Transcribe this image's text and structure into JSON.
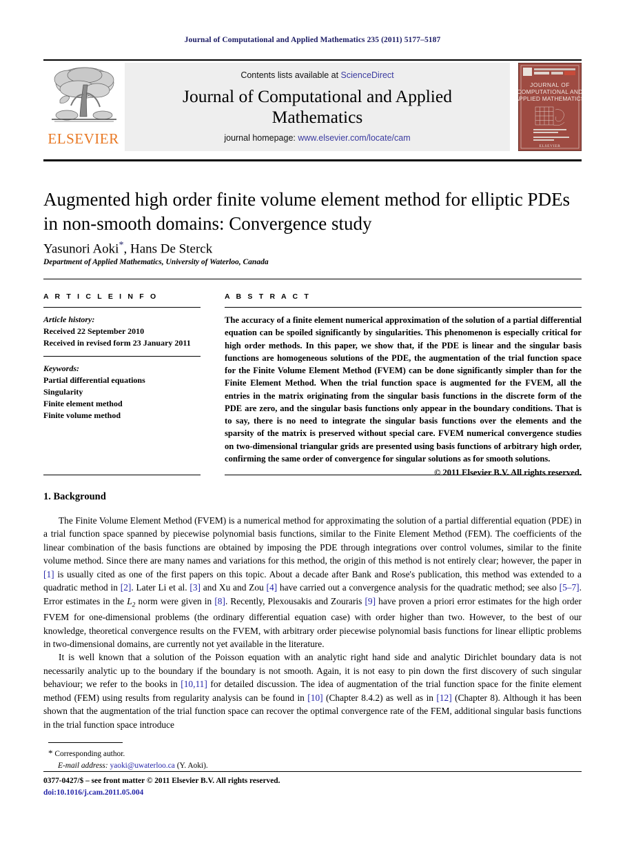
{
  "running_head": "Journal of Computational and Applied Mathematics 235 (2011) 5177–5187",
  "masthead": {
    "publisher_name": "ELSEVIER",
    "contents_prefix": "Contents lists available at ",
    "contents_link": "ScienceDirect",
    "journal_title": "Journal of Computational and Applied Mathematics",
    "homepage_prefix": "journal homepage: ",
    "homepage_url": "www.elsevier.com/locate/cam",
    "cover": {
      "line1": "JOURNAL OF",
      "line2": "COMPUTATIONAL AND",
      "line3": "APPLIED MATHEMATICS",
      "footer": "ELSEVIER"
    }
  },
  "article": {
    "title": "Augmented high order finite volume element method for elliptic PDEs in non-smooth domains: Convergence study",
    "authors": "Yasunori Aoki",
    "authors_rest": ", Hans De Sterck",
    "corresponding_marker": "*",
    "affiliation": "Department of Applied Mathematics, University of Waterloo, Canada"
  },
  "info": {
    "heading": "A R T I C L E    I N F O",
    "history_label": "Article history:",
    "history": [
      "Received 22 September 2010",
      "Received in revised form 23 January 2011"
    ],
    "keywords_label": "Keywords:",
    "keywords": [
      "Partial differential equations",
      "Singularity",
      "Finite element method",
      "Finite volume method"
    ]
  },
  "abstract": {
    "heading": "A B S T R A C T",
    "text": "The accuracy of a finite element numerical approximation of the solution of a partial differential equation can be spoiled significantly by singularities. This phenomenon is especially critical for high order methods. In this paper, we show that, if the PDE is linear and the singular basis functions are homogeneous solutions of the PDE, the augmentation of the trial function space for the Finite Volume Element Method (FVEM) can be done significantly simpler than for the Finite Element Method. When the trial function space is augmented for the FVEM, all the entries in the matrix originating from the singular basis functions in the discrete form of the PDE are zero, and the singular basis functions only appear in the boundary conditions. That is to say, there is no need to integrate the singular basis functions over the elements and the sparsity of the matrix is preserved without special care. FVEM numerical convergence studies on two-dimensional triangular grids are presented using basis functions of arbitrary high order, confirming the same order of convergence for singular solutions as for smooth solutions.",
    "copyright": "© 2011 Elsevier B.V. All rights reserved."
  },
  "body": {
    "section_number": "1.",
    "section_title": "Background",
    "para1_a": "The Finite Volume Element Method (FVEM) is a numerical method for approximating the solution of a partial differential equation (PDE) in a trial function space spanned by piecewise polynomial basis functions, similar to the Finite Element Method (FEM). The coefficients of the linear combination of the basis functions are obtained by imposing the PDE through integrations over control volumes, similar to the finite volume method. Since there are many names and variations for this method, the origin of this method is not entirely clear; however, the paper in ",
    "ref1": "[1]",
    "para1_b": " is usually cited as one of the first papers on this topic. About a decade after Bank and Rose's publication, this method was extended to a quadratic method in ",
    "ref2": "[2]",
    "para1_c": ". Later Li et al. ",
    "ref3": "[3]",
    "para1_d": " and Xu and Zou ",
    "ref4": "[4]",
    "para1_e": " have carried out a convergence analysis for the quadratic method; see also ",
    "ref5": "[5–7]",
    "para1_f": ". Error estimates in the ",
    "norm_symbol": "L",
    "norm_sub": "2",
    "para1_g": " norm were given in ",
    "ref8": "[8]",
    "para1_h": ". Recently, Plexousakis and Zouraris ",
    "ref9": "[9]",
    "para1_i": " have proven a priori error estimates for the high order FVEM for one-dimensional problems (the ordinary differential equation case) with order higher than two. However, to the best of our knowledge, theoretical convergence results on the FVEM, with arbitrary order piecewise polynomial basis functions for linear elliptic problems in two-dimensional domains, are currently not yet available in the literature.",
    "para2_a": "It is well known that a solution of the Poisson equation with an analytic right hand side and analytic Dirichlet boundary data is not necessarily analytic up to the boundary if the boundary is not smooth. Again, it is not easy to pin down the first discovery of such singular behaviour; we refer to the books in ",
    "ref1011": "[10,11]",
    "para2_b": " for detailed discussion. The idea of augmentation of the trial function space for the finite element method (FEM) using results from regularity analysis can be found in ",
    "ref10": "[10]",
    "para2_c": " (Chapter 8.4.2) as well as in ",
    "ref12": "[12]",
    "para2_d": " (Chapter 8). Although it has been shown that the augmentation of the trial function space can recover the optimal convergence rate of the FEM, additional singular basis functions in the trial function space introduce"
  },
  "footnote": {
    "marker": "*",
    "corresponding": "Corresponding author.",
    "email_label": "E-mail address:",
    "email": "yaoki@uwaterloo.ca",
    "email_owner": "(Y. Aoki)."
  },
  "imprint": {
    "line1": "0377-0427/$ – see front matter © 2011 Elsevier B.V. All rights reserved.",
    "doi": "doi:10.1016/j.cam.2011.05.004"
  },
  "colors": {
    "running_head": "#1b1b64",
    "link": "#3b3ba0",
    "reference": "#2525a8",
    "elsevier_orange": "#e87722",
    "masthead_bg": "#eeeeee",
    "cover_bg": "#9e4b42"
  }
}
